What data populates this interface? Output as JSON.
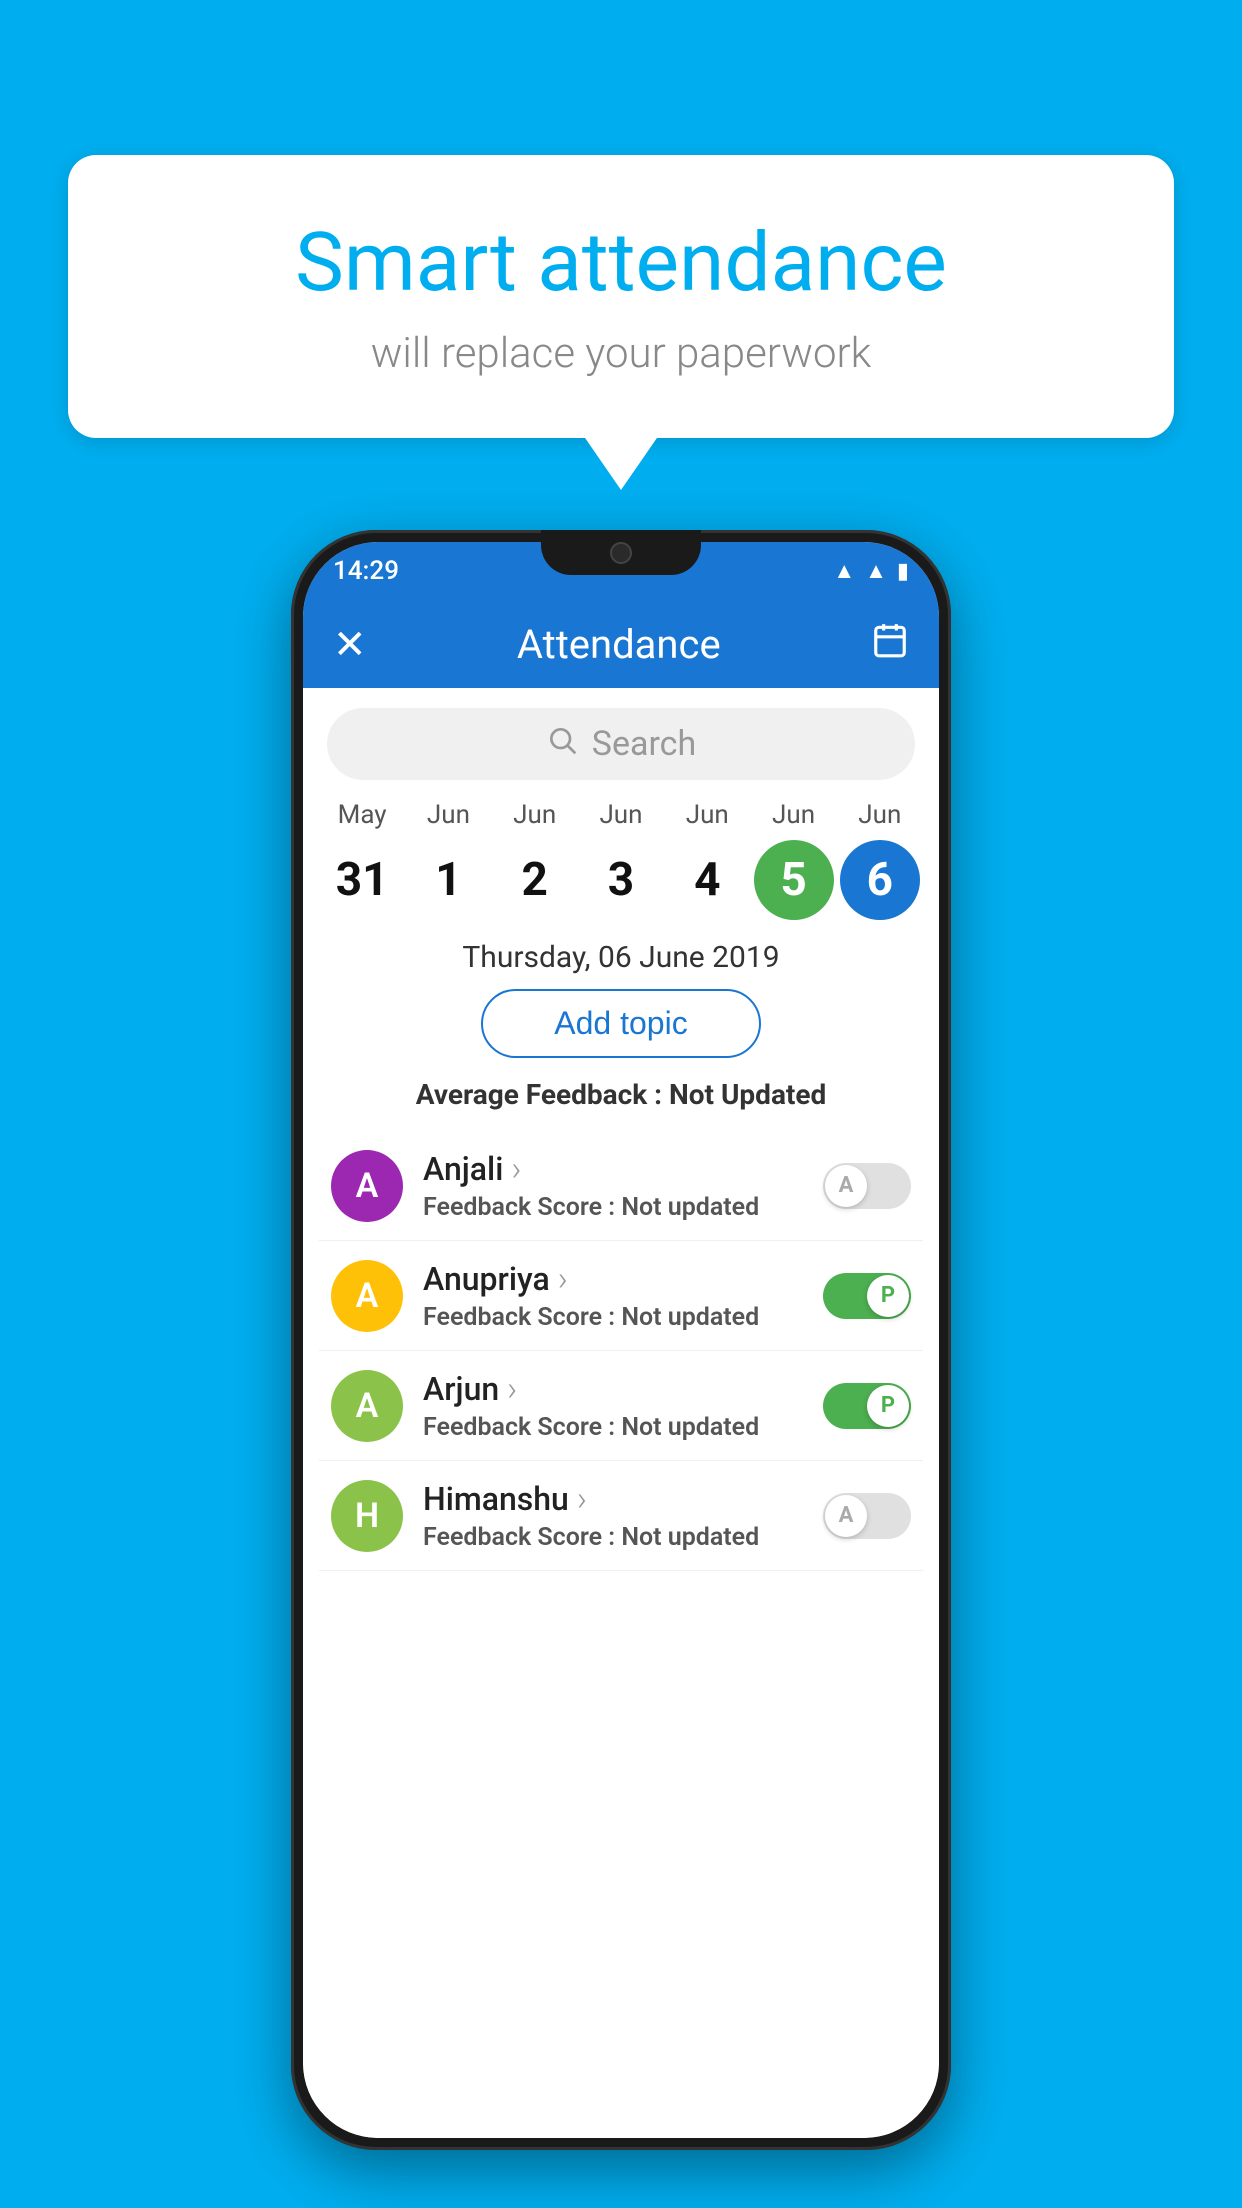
{
  "background_color": "#00AEEF",
  "speech_bubble": {
    "title": "Smart attendance",
    "subtitle": "will replace your paperwork"
  },
  "status_bar": {
    "time": "14:29",
    "wifi": "▲",
    "signal": "▲",
    "battery": "▮"
  },
  "header": {
    "title": "Attendance",
    "close_label": "✕",
    "calendar_icon": "🗓"
  },
  "search": {
    "placeholder": "Search"
  },
  "dates": [
    {
      "month": "May",
      "day": "31",
      "state": "normal"
    },
    {
      "month": "Jun",
      "day": "1",
      "state": "normal"
    },
    {
      "month": "Jun",
      "day": "2",
      "state": "normal"
    },
    {
      "month": "Jun",
      "day": "3",
      "state": "normal"
    },
    {
      "month": "Jun",
      "day": "4",
      "state": "normal"
    },
    {
      "month": "Jun",
      "day": "5",
      "state": "today"
    },
    {
      "month": "Jun",
      "day": "6",
      "state": "selected"
    }
  ],
  "selected_date_label": "Thursday, 06 June 2019",
  "add_topic_label": "Add topic",
  "avg_feedback_label": "Average Feedback : ",
  "avg_feedback_value": "Not Updated",
  "students": [
    {
      "name": "Anjali",
      "avatar_letter": "A",
      "avatar_color": "#9C27B0",
      "feedback_label": "Feedback Score : ",
      "feedback_value": "Not updated",
      "toggle_state": "off",
      "toggle_label": "A"
    },
    {
      "name": "Anupriya",
      "avatar_letter": "A",
      "avatar_color": "#FFC107",
      "feedback_label": "Feedback Score : ",
      "feedback_value": "Not updated",
      "toggle_state": "on",
      "toggle_label": "P"
    },
    {
      "name": "Arjun",
      "avatar_letter": "A",
      "avatar_color": "#8BC34A",
      "feedback_label": "Feedback Score : ",
      "feedback_value": "Not updated",
      "toggle_state": "on",
      "toggle_label": "P"
    },
    {
      "name": "Himanshu",
      "avatar_letter": "H",
      "avatar_color": "#8BC34A",
      "feedback_label": "Feedback Score : ",
      "feedback_value": "Not updated",
      "toggle_state": "off",
      "toggle_label": "A"
    }
  ]
}
